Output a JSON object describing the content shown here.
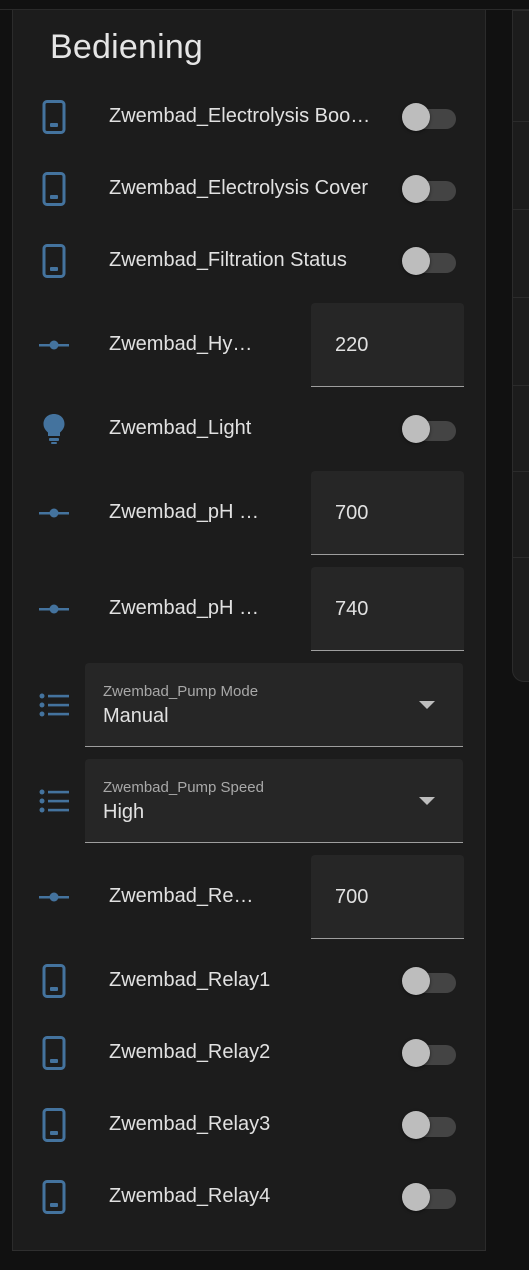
{
  "card": {
    "title": "Bediening"
  },
  "colors": {
    "icon": "#44739e",
    "background": "#1c1c1c",
    "text": "#e1e1e1"
  },
  "rows": [
    {
      "type": "toggle",
      "icon": "phone-icon",
      "label": "Zwembad_Electrolysis Boo…",
      "state": "off"
    },
    {
      "type": "toggle",
      "icon": "phone-icon",
      "label": "Zwembad_Electrolysis Cover",
      "state": "off"
    },
    {
      "type": "toggle",
      "icon": "phone-icon",
      "label": "Zwembad_Filtration Status",
      "state": "off"
    },
    {
      "type": "number",
      "icon": "slider-icon",
      "label": "Zwembad_Hy…",
      "value": "220"
    },
    {
      "type": "toggle",
      "icon": "lightbulb-icon",
      "label": "Zwembad_Light",
      "state": "off"
    },
    {
      "type": "number",
      "icon": "slider-icon",
      "label": "Zwembad_pH …",
      "value": "700"
    },
    {
      "type": "number",
      "icon": "slider-icon",
      "label": "Zwembad_pH …",
      "value": "740"
    },
    {
      "type": "select",
      "icon": "list-icon",
      "label": "Zwembad_Pump Mode",
      "value": "Manual"
    },
    {
      "type": "select",
      "icon": "list-icon",
      "label": "Zwembad_Pump Speed",
      "value": "High"
    },
    {
      "type": "number",
      "icon": "slider-icon",
      "label": "Zwembad_Re…",
      "value": "700"
    },
    {
      "type": "toggle",
      "icon": "phone-icon",
      "label": "Zwembad_Relay1",
      "state": "off"
    },
    {
      "type": "toggle",
      "icon": "phone-icon",
      "label": "Zwembad_Relay2",
      "state": "off"
    },
    {
      "type": "toggle",
      "icon": "phone-icon",
      "label": "Zwembad_Relay3",
      "state": "off"
    },
    {
      "type": "toggle",
      "icon": "phone-icon",
      "label": "Zwembad_Relay4",
      "state": "off"
    }
  ]
}
